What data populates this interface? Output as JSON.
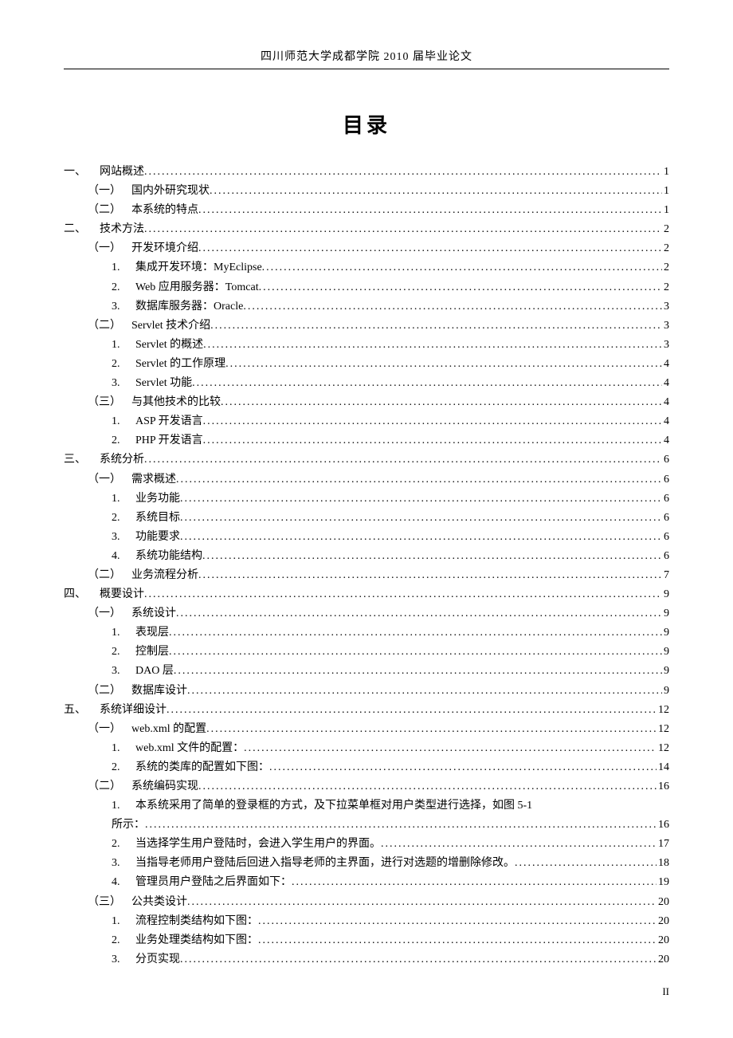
{
  "header": "四川师范大学成都学院 2010 届毕业论文",
  "title": "目录",
  "footer": "II",
  "toc": [
    {
      "level": 1,
      "label": "一、",
      "text": "网站概述",
      "page": "1"
    },
    {
      "level": 2,
      "label": "（一）",
      "text": "国内外研究现状",
      "page": "1"
    },
    {
      "level": 2,
      "label": "（二）",
      "text": "本系统的特点",
      "page": "1"
    },
    {
      "level": 1,
      "label": "二、",
      "text": "技术方法",
      "page": "2"
    },
    {
      "level": 2,
      "label": "（一）",
      "text": "开发环境介绍",
      "page": "2"
    },
    {
      "level": 3,
      "label": "1.",
      "text": "集成开发环境：MyEclipse",
      "page": "2"
    },
    {
      "level": 3,
      "label": "2.",
      "text": "Web 应用服务器：Tomcat",
      "page": "2"
    },
    {
      "level": 3,
      "label": "3.",
      "text": "数据库服务器：Oracle",
      "page": "3"
    },
    {
      "level": 2,
      "label": "（二）",
      "text": "Servlet 技术介绍",
      "page": "3"
    },
    {
      "level": 3,
      "label": "1.",
      "text": "Servlet 的概述",
      "page": "3"
    },
    {
      "level": 3,
      "label": "2.",
      "text": "Servlet 的工作原理",
      "page": "4"
    },
    {
      "level": 3,
      "label": "3.",
      "text": "Servlet 功能",
      "page": "4"
    },
    {
      "level": 2,
      "label": "（三）",
      "text": "与其他技术的比较",
      "page": "4"
    },
    {
      "level": 3,
      "label": "1.",
      "text": "ASP 开发语言",
      "page": "4"
    },
    {
      "level": 3,
      "label": "2.",
      "text": "PHP 开发语言",
      "page": "4"
    },
    {
      "level": 1,
      "label": "三、",
      "text": "系统分析",
      "page": "6"
    },
    {
      "level": 2,
      "label": "（一）",
      "text": "需求概述",
      "page": "6"
    },
    {
      "level": 3,
      "label": "1.",
      "text": "业务功能",
      "page": "6"
    },
    {
      "level": 3,
      "label": "2.",
      "text": "系统目标",
      "page": "6"
    },
    {
      "level": 3,
      "label": "3.",
      "text": "功能要求",
      "page": "6"
    },
    {
      "level": 3,
      "label": "4.",
      "text": "系统功能结构",
      "page": "6"
    },
    {
      "level": 2,
      "label": "（二）",
      "text": "业务流程分析",
      "page": "7"
    },
    {
      "level": 1,
      "label": "四、",
      "text": "概要设计",
      "page": "9"
    },
    {
      "level": 2,
      "label": "（一）",
      "text": "系统设计",
      "page": "9"
    },
    {
      "level": 3,
      "label": "1.",
      "text": "表现层",
      "page": "9"
    },
    {
      "level": 3,
      "label": "2.",
      "text": "控制层",
      "page": "9"
    },
    {
      "level": 3,
      "label": "3.",
      "text": "DAO 层",
      "page": "9"
    },
    {
      "level": 2,
      "label": "（二）",
      "text": "数据库设计",
      "page": "9"
    },
    {
      "level": 1,
      "label": "五、",
      "text": "系统详细设计",
      "page": "12"
    },
    {
      "level": 2,
      "label": "（一）",
      "text": "web.xml 的配置",
      "page": "12"
    },
    {
      "level": 3,
      "label": "1.",
      "text": "web.xml 文件的配置：",
      "page": "12"
    },
    {
      "level": 3,
      "label": "2.",
      "text": "系统的类库的配置如下图：",
      "page": "14"
    },
    {
      "level": 2,
      "label": "（二）",
      "text": "系统编码实现",
      "page": "16"
    },
    {
      "level": 3,
      "label": "1.",
      "text": "本系统采用了简单的登录框的方式，及下拉菜单框对用户类型进行选择，如图 5-1",
      "page": "",
      "nodots": true
    },
    {
      "level": 3,
      "label": "所示：",
      "text": "",
      "page": "16"
    },
    {
      "level": 3,
      "label": "2.",
      "text": "当选择学生用户登陆时，会进入学生用户的界面。",
      "page": "17"
    },
    {
      "level": 3,
      "label": "3.",
      "text": "当指导老师用户登陆后回进入指导老师的主界面，进行对选题的增删除修改。",
      "page": "18"
    },
    {
      "level": 3,
      "label": "4.",
      "text": "管理员用户登陆之后界面如下：",
      "page": "19"
    },
    {
      "level": 2,
      "label": "（三）",
      "text": "公共类设计",
      "page": "20"
    },
    {
      "level": 3,
      "label": "1.",
      "text": "流程控制类结构如下图：",
      "page": "20"
    },
    {
      "level": 3,
      "label": "2.",
      "text": "业务处理类结构如下图：",
      "page": "20"
    },
    {
      "level": 3,
      "label": "3.",
      "text": "分页实现",
      "page": "20"
    }
  ]
}
